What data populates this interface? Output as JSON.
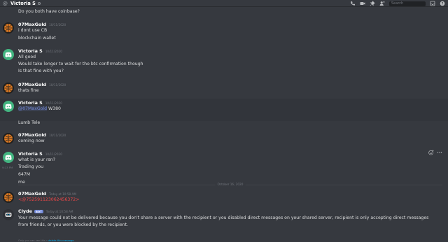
{
  "header": {
    "at_symbol": "@",
    "title": "Victoria S",
    "search_placeholder": "Search"
  },
  "icons": {
    "status": "status-dot-icon",
    "call": "phone-call-icon",
    "video": "video-call-icon",
    "pin": "pin-icon",
    "add_member": "add-member-icon",
    "inbox": "inbox-icon",
    "help": "help-icon"
  },
  "messages": {
    "m0": {
      "line1": "Do you both have coinbase?"
    },
    "m1": {
      "username": "07MaxGold",
      "timestamp": "10/11/2020",
      "line1": "i dont use CB",
      "line2": "blockchain wallet"
    },
    "m2": {
      "username": "Victoria S",
      "timestamp": "10/11/2020",
      "line1": "All good",
      "line2": "Would take longer to wait for the btc confirmation though",
      "line3": "Is that fine with you?"
    },
    "m3": {
      "username": "07MaxGold",
      "timestamp": "10/11/2020",
      "line1": "thats fine"
    },
    "m4": {
      "username": "Victoria S",
      "timestamp": "10/11/2020",
      "mention": "@07MaxGold",
      "text_after": " W380",
      "line2": "Lumb Tele"
    },
    "m5": {
      "username": "07MaxGold",
      "timestamp": "10/11/2020",
      "line1": "coming now"
    },
    "m6": {
      "username": "Victoria S",
      "timestamp": "10/11/2020",
      "line1": "what is your rsn?",
      "side_time": "9:13 PM",
      "line2": "Trading you",
      "line3": "647M",
      "line4": "me"
    },
    "divider": "October 16, 2020",
    "m7": {
      "username": "07MaxGold",
      "timestamp": "Today at 10:58 AM",
      "line1": "<@752591123062456372>"
    },
    "m8": {
      "username": "Clyde",
      "badge": "BOT",
      "timestamp": "Today at 10:58 AM",
      "body": "Your message could not be delivered because you don't share a server with the recipient or you disabled direct messages on your shared server, recipient is only accepting direct messages from friends, or you were blocked by the recipient.",
      "footnote_prefix": "Only you can see this •",
      "footnote_link": "delete this message"
    }
  }
}
